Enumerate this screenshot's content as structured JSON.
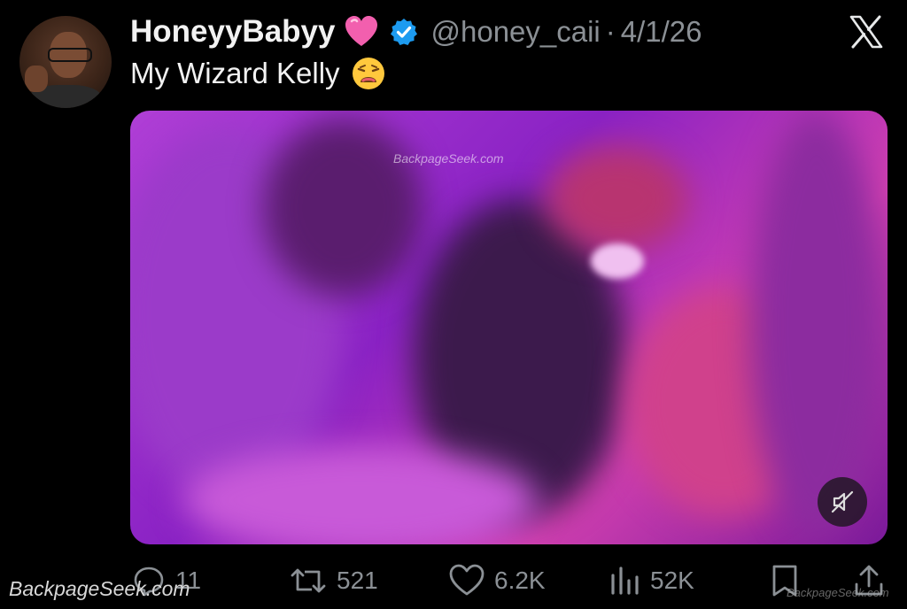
{
  "tweet": {
    "display_name": "HoneyyBabyy",
    "handle": "@honey_caii",
    "separator": "·",
    "date": "4/1/26",
    "text": "My Wizard Kelly",
    "name_emoji": "pink-heart-icon",
    "text_emoji": "weary-face-icon",
    "verified": true
  },
  "media": {
    "type": "video",
    "watermark": "BackpageSeek.com",
    "muted": true
  },
  "actions": {
    "replies": "11",
    "reposts": "521",
    "likes": "6.2K",
    "views": "52K"
  },
  "watermarks": {
    "bottom_left": "BackpageSeek.com",
    "bottom_right": "BackpageSeek.com"
  },
  "colors": {
    "background": "#000000",
    "text": "#e7e9ea",
    "secondary": "#8b9095",
    "verified": "#1d9bf0",
    "heart": "#f25fae"
  }
}
